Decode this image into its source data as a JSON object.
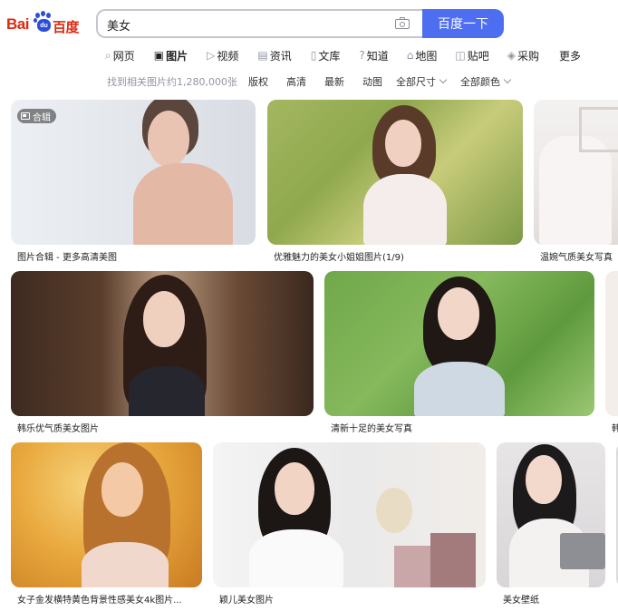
{
  "logo": {
    "text_left": "Bai",
    "paw_text": "du",
    "text_right": "百度"
  },
  "search": {
    "query": "美女",
    "button_label": "百度一下"
  },
  "tabs": [
    {
      "label": "网页",
      "icon": "search-icon",
      "glyph": "⌕",
      "active": false
    },
    {
      "label": "图片",
      "icon": "image-icon",
      "glyph": "▣",
      "active": true
    },
    {
      "label": "视频",
      "icon": "video-icon",
      "glyph": "▷",
      "active": false
    },
    {
      "label": "资讯",
      "icon": "news-icon",
      "glyph": "▤",
      "active": false
    },
    {
      "label": "文库",
      "icon": "document-icon",
      "glyph": "▯",
      "active": false
    },
    {
      "label": "知道",
      "icon": "question-icon",
      "glyph": "?",
      "active": false
    },
    {
      "label": "地图",
      "icon": "map-icon",
      "glyph": "⌂",
      "active": false
    },
    {
      "label": "贴吧",
      "icon": "tieba-icon",
      "glyph": "◫",
      "active": false
    },
    {
      "label": "采购",
      "icon": "shopping-icon",
      "glyph": "◈",
      "active": false
    },
    {
      "label": "更多",
      "icon": "",
      "glyph": "",
      "active": false
    }
  ],
  "filters": {
    "count_text": "找到相关图片约1,280,000张",
    "items": [
      "版权",
      "高清",
      "最新",
      "动图"
    ],
    "size_dropdown": "全部尺寸",
    "color_dropdown": "全部颜色"
  },
  "results": [
    {
      "caption": "图片合辑 - 更多高清美图",
      "badge": "合辑"
    },
    {
      "caption": "优雅魅力的美女小姐姐图片(1/9)"
    },
    {
      "caption": "温婉气质美女写真"
    },
    {
      "caption": "韩乐优气质美女图片"
    },
    {
      "caption": "清新十足的美女写真"
    },
    {
      "caption": "韩"
    },
    {
      "caption": "女子金发横特黄色背景性感美女4k图片..."
    },
    {
      "caption": "颖儿美女图片"
    },
    {
      "caption": "美女壁纸"
    }
  ],
  "colors": {
    "brand_red": "#de2910",
    "brand_blue": "#2b4ed8",
    "button_blue": "#4e6ef2"
  }
}
